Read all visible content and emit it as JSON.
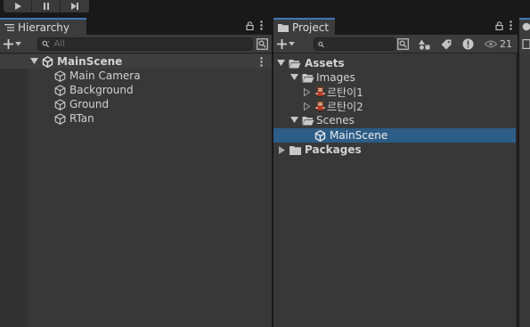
{
  "toolbar": {
    "buttons": [
      {
        "name": "play",
        "icon": "play-icon"
      },
      {
        "name": "pause",
        "icon": "pause-icon"
      },
      {
        "name": "step",
        "icon": "step-icon"
      }
    ]
  },
  "hierarchy": {
    "tab_label": "Hierarchy",
    "search_placeholder": "All",
    "scene": "MainScene",
    "objects": [
      "Main Camera",
      "Background",
      "Ground",
      "RTan"
    ]
  },
  "project": {
    "tab_label": "Project",
    "search_placeholder": "",
    "visibility_count": "21",
    "tree": {
      "assets": "Assets",
      "images": "Images",
      "image_items": [
        "르탄이1",
        "르탄이2"
      ],
      "scenes": "Scenes",
      "scene_item": "MainScene",
      "packages": "Packages"
    }
  },
  "colors": {
    "tab_accent": "#3a79bb",
    "selection": "#2c5d87",
    "panel_bg": "#383838"
  }
}
